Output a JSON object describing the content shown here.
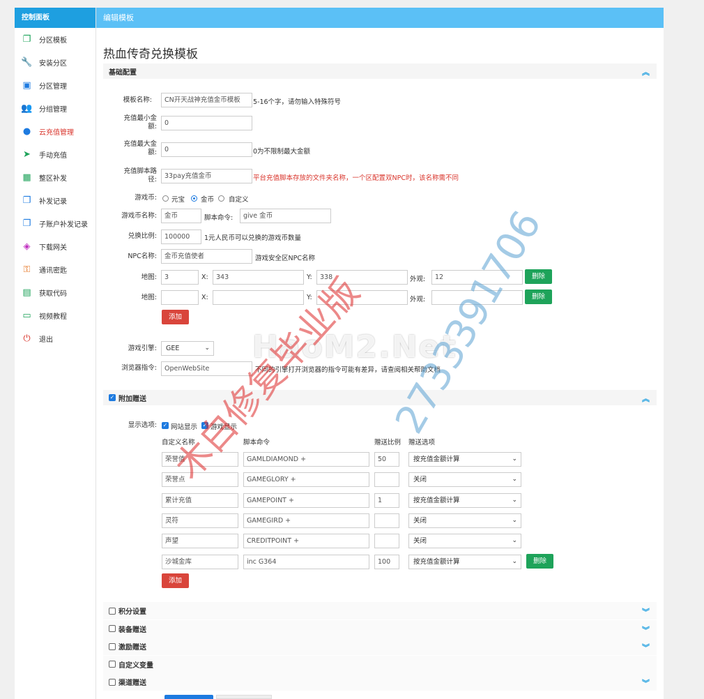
{
  "sidebar": {
    "header": "控制面板",
    "items": [
      {
        "label": "分区模板",
        "icon": "copy-icon",
        "color": "#1ea35a"
      },
      {
        "label": "安装分区",
        "icon": "wrench-icon",
        "color": "#e4a11b"
      },
      {
        "label": "分区管理",
        "icon": "inbox-icon",
        "color": "#1e7be0"
      },
      {
        "label": "分组管理",
        "icon": "users-icon",
        "color": "#1ea35a"
      },
      {
        "label": "云充值管理",
        "icon": "user-icon",
        "color": "#1e7be0",
        "active": true
      },
      {
        "label": "手动充值",
        "icon": "send-icon",
        "color": "#1ea35a"
      },
      {
        "label": "整区补发",
        "icon": "calendar-icon",
        "color": "#1ea35a"
      },
      {
        "label": "补发记录",
        "icon": "copy-icon",
        "color": "#1e7be0"
      },
      {
        "label": "子账户补发记录",
        "icon": "copy-icon",
        "color": "#1e7be0"
      },
      {
        "label": "下载网关",
        "icon": "stack-icon",
        "color": "#c030c0"
      },
      {
        "label": "通讯密匙",
        "icon": "key-icon",
        "color": "#e4701b"
      },
      {
        "label": "获取代码",
        "icon": "briefcase-icon",
        "color": "#1ea35a"
      },
      {
        "label": "视频教程",
        "icon": "video-icon",
        "color": "#1ea35a"
      },
      {
        "label": "退出",
        "icon": "power-icon",
        "color": "#d9342b"
      }
    ]
  },
  "topbar": {
    "title": "编辑模板"
  },
  "page_title": "热血传奇兑换模板",
  "basic": {
    "title": "基础配置",
    "template_name_label": "模板名称:",
    "template_name_value": "CN开天战神充值金币模板",
    "template_name_hint": "5-16个字，请勿输入特殊符号",
    "min_label_1": "充值最小金",
    "min_label_2": "额:",
    "min_value": "0",
    "max_label_1": "充值最大金",
    "max_label_2": "额:",
    "max_value": "0",
    "max_hint": "0为不限制最大金额",
    "script_label_1": "充值脚本路",
    "script_label_2": "径:",
    "script_value": "33pay充值金币",
    "script_hint": "平台充值脚本存放的文件夹名称，一个区配置双NPC时，该名称需不同",
    "currency_label": "游戏币:",
    "currency_options": [
      "元宝",
      "金币",
      "自定义"
    ],
    "coin_name_label": "游戏币名称:",
    "coin_name_value": "金币",
    "script_cmd_label": "脚本命令:",
    "script_cmd_value": "give 金币",
    "ratio_label": "兑换比例:",
    "ratio_value": "100000",
    "ratio_hint": "1元人民币可以兑换的游戏币数量",
    "npc_label": "NPC名称:",
    "npc_value": "金币充值使者",
    "npc_hint": "游戏安全区NPC名称",
    "map_label": "地图:",
    "x_label": "X:",
    "y_label": "Y:",
    "look_label": "外观:",
    "maps": [
      {
        "map": "3",
        "x": "343",
        "y": "338",
        "look": "12"
      },
      {
        "map": "",
        "x": "",
        "y": "",
        "look": ""
      }
    ],
    "delete_label": "删除",
    "add_label": "添加",
    "engine_label": "游戏引擎:",
    "engine_value": "GEE",
    "browser_label": "浏览器指令:",
    "browser_value": "OpenWebSite",
    "browser_hint": "不同的引擎打开浏览器的指令可能有差异，请查阅相关帮助文档"
  },
  "extra": {
    "title": "附加赠送",
    "display_label": "显示选项:",
    "show_web": "网站显示",
    "show_game": "游戏显示",
    "col_name": "自定义名称",
    "col_cmd": "脚本命令",
    "col_ratio": "赠送比例",
    "col_option": "赠送选项",
    "rows": [
      {
        "name": "荣誉值",
        "cmd": "GAMLDIAMOND +",
        "ratio": "50",
        "option": "按充值金额计算"
      },
      {
        "name": "荣誉点",
        "cmd": "GAMEGLORY +",
        "ratio": "",
        "option": "关闭"
      },
      {
        "name": "累计充值",
        "cmd": "GAMEPOINT +",
        "ratio": "1",
        "option": "按充值金额计算"
      },
      {
        "name": "灵符",
        "cmd": "GAMEGIRD +",
        "ratio": "",
        "option": "关闭"
      },
      {
        "name": "声望",
        "cmd": "CREDITPOINT +",
        "ratio": "",
        "option": "关闭"
      },
      {
        "name": "沙城金库",
        "cmd": "inc G364",
        "ratio": "100",
        "option": "按充值金额计算"
      }
    ],
    "delete_label": "删除",
    "add_label": "添加"
  },
  "folded": [
    "积分设置",
    "装备赠送",
    "激励赠送",
    "自定义变量",
    "渠道赠送"
  ],
  "watermark": {
    "line1": "HaoM2.Net",
    "line2": "木白修复毕业版",
    "line3": "2733391706"
  }
}
